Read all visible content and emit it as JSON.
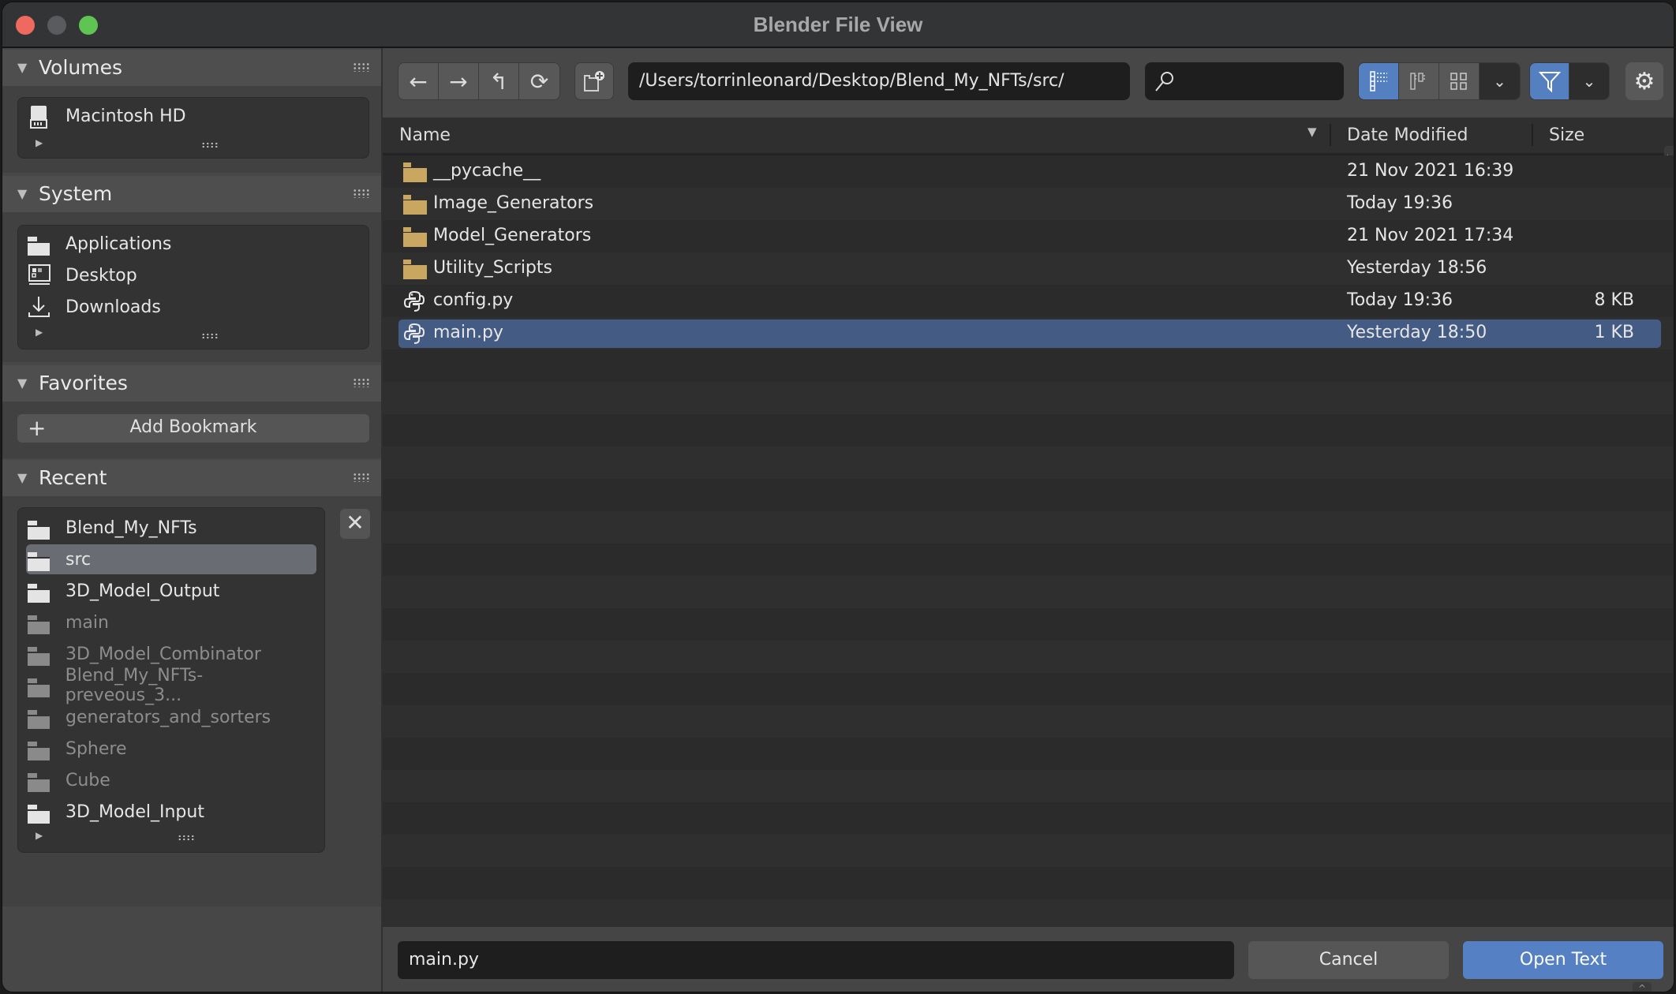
{
  "window": {
    "title": "Blender File View"
  },
  "sidebar": {
    "volumes": {
      "label": "Volumes",
      "items": [
        {
          "label": "Macintosh HD",
          "icon": "disk-icon"
        }
      ]
    },
    "system": {
      "label": "System",
      "items": [
        {
          "label": "Applications",
          "icon": "folder-icon"
        },
        {
          "label": "Desktop",
          "icon": "desktop-icon"
        },
        {
          "label": "Downloads",
          "icon": "download-icon"
        }
      ]
    },
    "favorites": {
      "label": "Favorites",
      "add_bookmark": "Add Bookmark"
    },
    "recent": {
      "label": "Recent",
      "items": [
        {
          "label": "Blend_My_NFTs",
          "state": "normal"
        },
        {
          "label": "src",
          "state": "selected"
        },
        {
          "label": "3D_Model_Output",
          "state": "normal"
        },
        {
          "label": "main",
          "state": "missing"
        },
        {
          "label": "3D_Model_Combinator",
          "state": "missing"
        },
        {
          "label": "Blend_My_NFTs-preveous_3...",
          "state": "missing"
        },
        {
          "label": "generators_and_sorters",
          "state": "missing"
        },
        {
          "label": "Sphere",
          "state": "missing"
        },
        {
          "label": "Cube",
          "state": "missing"
        },
        {
          "label": "3D_Model_Input",
          "state": "normal"
        }
      ]
    }
  },
  "toolbar": {
    "path": "/Users/torrinleonard/Desktop/Blend_My_NFTs/src/",
    "search_value": "",
    "display_mode": "vertical-list",
    "filter_enabled": true
  },
  "columns": {
    "name": "Name",
    "date": "Date Modified",
    "size": "Size"
  },
  "files": [
    {
      "name": "__pycache__",
      "type": "folder",
      "date": "21 Nov 2021 16:39",
      "size": ""
    },
    {
      "name": "Image_Generators",
      "type": "folder",
      "date": "Today 19:36",
      "size": ""
    },
    {
      "name": "Model_Generators",
      "type": "folder",
      "date": "21 Nov 2021 17:34",
      "size": ""
    },
    {
      "name": "Utility_Scripts",
      "type": "folder",
      "date": "Yesterday 18:56",
      "size": ""
    },
    {
      "name": "config.py",
      "type": "python",
      "date": "Today 19:36",
      "size": "8 KB"
    },
    {
      "name": "main.py",
      "type": "python",
      "date": "Yesterday 18:50",
      "size": "1 KB",
      "selected": true
    }
  ],
  "footer": {
    "filename": "main.py",
    "cancel": "Cancel",
    "confirm": "Open Text"
  },
  "colors": {
    "accent": "#5580c4",
    "selection": "#445b84",
    "folder": "#c9a760"
  }
}
